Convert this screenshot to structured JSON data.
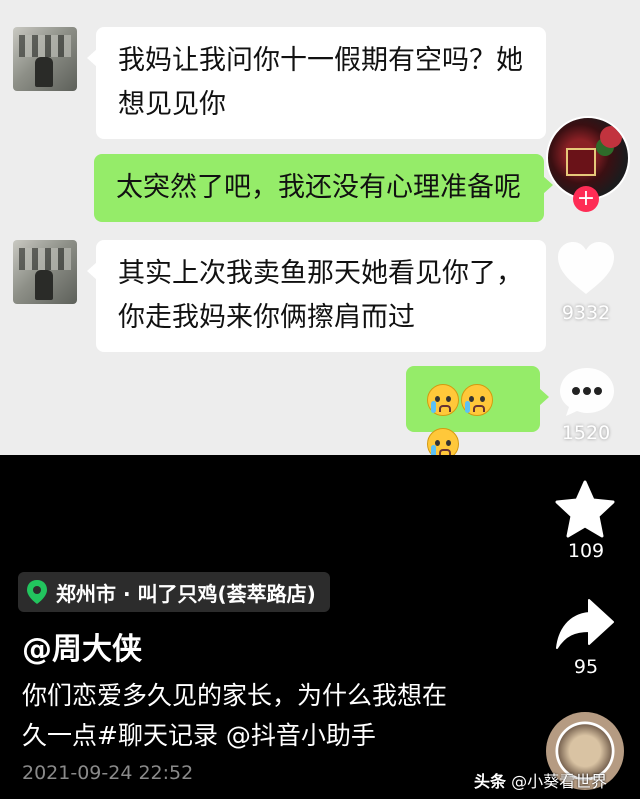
{
  "chat": {
    "messages": [
      {
        "side": "left",
        "text1": "我妈让我问你十一假期有空吗？她",
        "text2": "想见见你"
      },
      {
        "side": "right",
        "text": "太突然了吧，我还没有心理准备呢"
      },
      {
        "side": "left",
        "text1": "其实上次我卖鱼那天她看见你了，",
        "text2": "你走我妈来你俩擦肩而过"
      },
      {
        "side": "right",
        "emoji": [
          "crying-face",
          "crying-face",
          "crying-face"
        ]
      }
    ]
  },
  "sidebar": {
    "plus": "+",
    "likes": "9332",
    "comments": "1520",
    "favorites": "109",
    "shares": "95"
  },
  "post": {
    "location": "郑州市 · 叫了只鸡(荟萃路店)",
    "author": "@周大侠",
    "caption_line1": "你们恋爱多久见的家长，为什么我想在",
    "caption_line2": "久一点#聊天记录 @抖音小助手",
    "date": "2021-09-24 22:52"
  },
  "watermark": {
    "source": "头条",
    "account": "@小葵看世界"
  },
  "colors": {
    "green_bubble": "#95ec69",
    "chat_bg": "#ededed",
    "accent_red": "#fe2c55",
    "location_pin": "#22c55e"
  }
}
